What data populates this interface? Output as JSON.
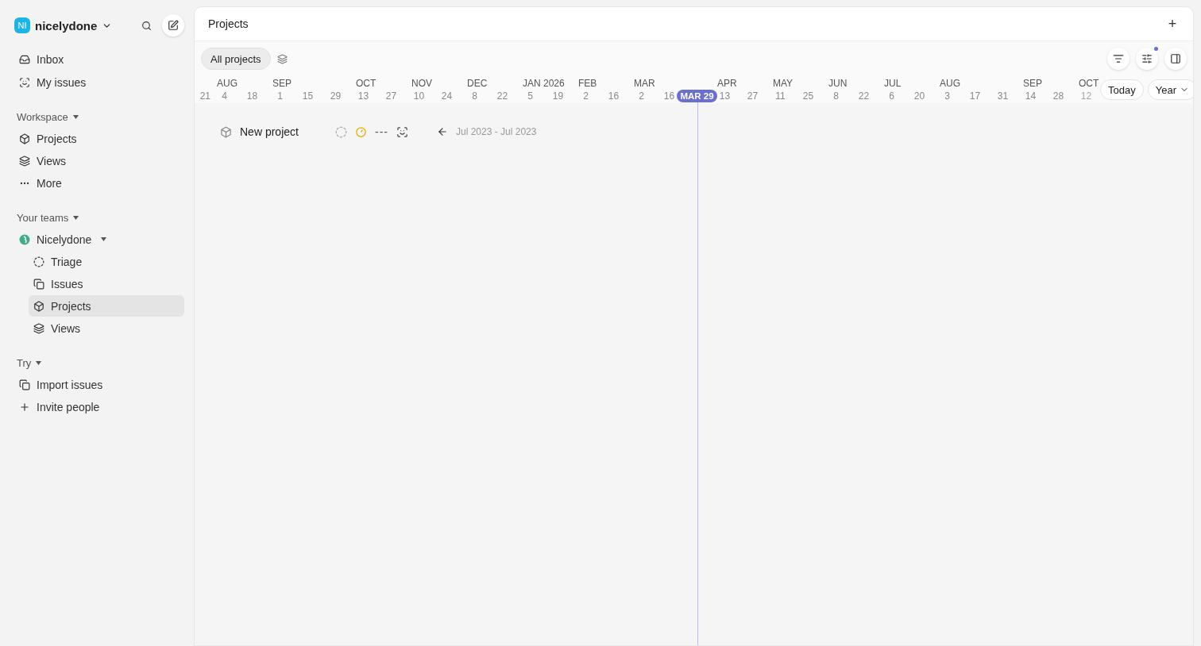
{
  "workspace": {
    "initials": "NI",
    "name": "nicelydone"
  },
  "nav": [
    {
      "label": "Inbox"
    },
    {
      "label": "My issues"
    }
  ],
  "sections": [
    {
      "title": "Workspace",
      "items": [
        {
          "label": "Projects",
          "selected": false
        },
        {
          "label": "Views",
          "selected": false
        },
        {
          "label": "More",
          "selected": false
        }
      ]
    },
    {
      "title": "Your teams",
      "team": {
        "name": "Nicelydone",
        "items": [
          {
            "label": "Triage",
            "selected": false
          },
          {
            "label": "Issues",
            "selected": false
          },
          {
            "label": "Projects",
            "selected": true
          },
          {
            "label": "Views",
            "selected": false
          }
        ]
      }
    },
    {
      "title": "Try",
      "items": [
        {
          "label": "Import issues",
          "selected": false
        },
        {
          "label": "Invite people",
          "selected": false
        }
      ]
    }
  ],
  "header": {
    "title": "Projects",
    "add": "+"
  },
  "toolbar": {
    "view": "All projects"
  },
  "timeline": {
    "lead": "21",
    "months": [
      {
        "label": "AUG",
        "days": [
          {
            "label": "4",
            "today": false
          },
          {
            "label": "18",
            "today": false
          }
        ]
      },
      {
        "label": "SEP",
        "days": [
          {
            "label": "1",
            "today": false
          },
          {
            "label": "15",
            "today": false
          },
          {
            "label": "29",
            "today": false
          }
        ]
      },
      {
        "label": "OCT",
        "days": [
          {
            "label": "13",
            "today": false
          },
          {
            "label": "27",
            "today": false
          }
        ]
      },
      {
        "label": "NOV",
        "days": [
          {
            "label": "10",
            "today": false
          },
          {
            "label": "24",
            "today": false
          }
        ]
      },
      {
        "label": "DEC",
        "days": [
          {
            "label": "8",
            "today": false
          },
          {
            "label": "22",
            "today": false
          }
        ]
      },
      {
        "label": "JAN 2026",
        "days": [
          {
            "label": "5",
            "today": false
          },
          {
            "label": "19",
            "today": false
          }
        ]
      },
      {
        "label": "FEB",
        "days": [
          {
            "label": "2",
            "today": false
          },
          {
            "label": "16",
            "today": false
          }
        ]
      },
      {
        "label": "MAR",
        "days": [
          {
            "label": "2",
            "today": false
          },
          {
            "label": "16",
            "today": false
          },
          {
            "label": "MAR 29",
            "today": true
          }
        ]
      },
      {
        "label": "APR",
        "days": [
          {
            "label": "13",
            "today": false
          },
          {
            "label": "27",
            "today": false
          }
        ]
      },
      {
        "label": "MAY",
        "days": [
          {
            "label": "11",
            "today": false
          },
          {
            "label": "25",
            "today": false
          }
        ]
      },
      {
        "label": "JUN",
        "days": [
          {
            "label": "8",
            "today": false
          },
          {
            "label": "22",
            "today": false
          }
        ]
      },
      {
        "label": "JUL",
        "days": [
          {
            "label": "6",
            "today": false
          },
          {
            "label": "20",
            "today": false
          }
        ]
      },
      {
        "label": "AUG",
        "days": [
          {
            "label": "3",
            "today": false
          },
          {
            "label": "17",
            "today": false
          },
          {
            "label": "31",
            "today": false
          }
        ]
      },
      {
        "label": "SEP",
        "days": [
          {
            "label": "14",
            "today": false
          },
          {
            "label": "28",
            "today": false
          }
        ]
      },
      {
        "label": "OCT",
        "days": [
          {
            "label": "12",
            "today": false
          }
        ]
      }
    ],
    "today_button": "Today",
    "scale": "Year"
  },
  "projects": [
    {
      "name": "New project",
      "dates": "Jul 2023 - Jul 2023",
      "priority": "---"
    }
  ]
}
